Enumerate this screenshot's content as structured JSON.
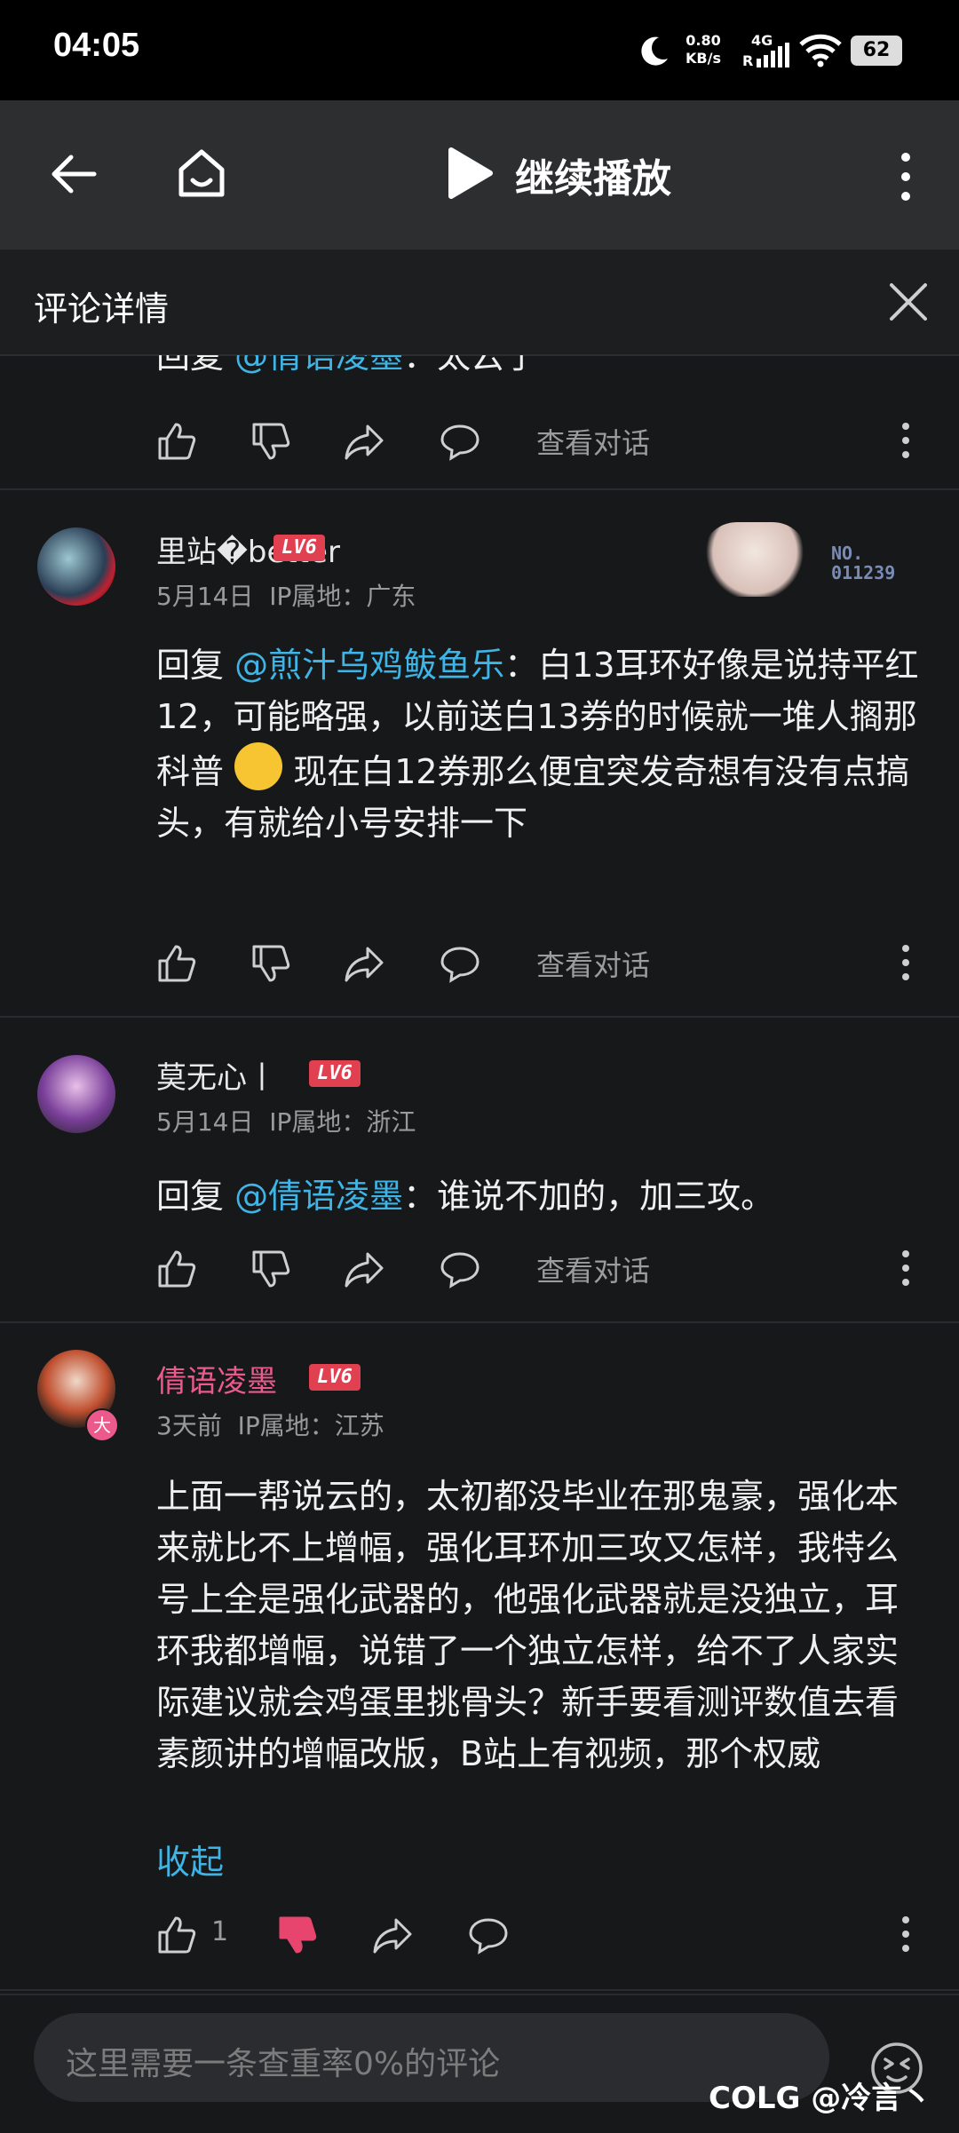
{
  "status": {
    "time": "04:05",
    "net_speed": "0.80",
    "net_unit": "KB/s",
    "signal": "4G",
    "battery": "62"
  },
  "appbar": {
    "play_label": "继续播放"
  },
  "subheader": {
    "title": "评论详情"
  },
  "comments": [
    {
      "text_prefix": "回复 ",
      "mention": "@倩语凌墨",
      "text": "：太云了",
      "view_label": "查看对话"
    },
    {
      "username": "里站�better",
      "level": "LV6",
      "date": "5月14日",
      "ip": "IP属地：广东",
      "badge_no": "NO.",
      "badge_num": "011239",
      "text_prefix": "回复 ",
      "mention": "@煎汁乌鸡鲅鱼乐",
      "text": "：白13耳环好像是说持平红12，可能略强，以前送白13券的时候就一堆人搁那科普",
      "text2": "现在白12券那么便宜突发奇想有没有点搞头，有就给小号安排一下",
      "view_label": "查看对话"
    },
    {
      "username": "莫无心丨",
      "level": "LV6",
      "date": "5月14日",
      "ip": "IP属地：浙江",
      "text_prefix": "回复 ",
      "mention": "@倩语凌墨",
      "text": "：谁说不加的，加三攻。",
      "view_label": "查看对话"
    },
    {
      "username": "倩语凌墨",
      "level": "LV6",
      "date": "3天前",
      "ip": "IP属地：江苏",
      "text": "上面一帮说云的，太初都没毕业在那鬼豪，强化本来就比不上增幅，强化耳环加三攻又怎样，我特么号上全是强化武器的，他强化武器就是没独立，耳环我都增幅，说错了一个独立怎样，给不了人家实际建议就会鸡蛋里挑骨头？新手要看测评数值去看素颜讲的增幅改版，B站上有视频，那个权威",
      "collapse": "收起",
      "like_count": "1",
      "avatar_badge": "大"
    }
  ],
  "bottom": {
    "placeholder": "这里需要一条查重率0%的评论"
  },
  "watermark": "COLG @冷言丶",
  "colors": {
    "accent": "#3eb5e6",
    "pink_name": "#ec5a8c",
    "dislike_active": "#e8456e",
    "level_badge": "#e04050"
  }
}
